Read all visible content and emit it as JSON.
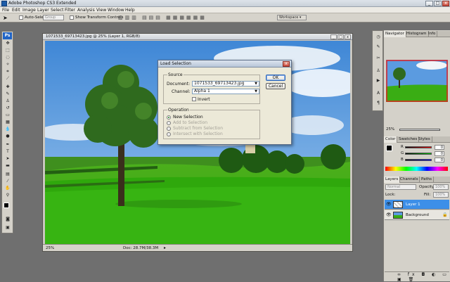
{
  "app": {
    "title": "Adobe Photoshop CS3 Extended",
    "logo": "Ps"
  },
  "menu": [
    "File",
    "Edit",
    "Image",
    "Layer",
    "Select",
    "Filter",
    "Analysis",
    "View",
    "Window",
    "Help"
  ],
  "options": {
    "auto_select": "Auto-Select:",
    "auto_select_value": "Group",
    "show_transform": "Show Transform Controls",
    "workspace": "Workspace"
  },
  "document": {
    "title": "1071533_69713423.jpg @ 25% (Layer 1, RGB/8)",
    "zoom": "25%",
    "doc_info": "Doc: 28.7M/38.3M"
  },
  "dialog": {
    "title": "Load Selection",
    "source_label": "Source",
    "document_label": "Document:",
    "document_value": "1071533_69713423.jpg",
    "channel_label": "Channel:",
    "channel_value": "Alpha 1",
    "invert_label": "Invert",
    "operation_label": "Operation",
    "ops": [
      "New Selection",
      "Add to Selection",
      "Subtract from Selection",
      "Intersect with Selection"
    ],
    "ok": "OK",
    "cancel": "Cancel"
  },
  "navigator": {
    "tabs": [
      "Navigator",
      "Histogram",
      "Info"
    ],
    "zoom": "25%"
  },
  "color": {
    "tabs": [
      "Color",
      "Swatches",
      "Styles"
    ],
    "r_label": "R",
    "g_label": "G",
    "b_label": "B",
    "r": "0",
    "g": "0",
    "b": "0"
  },
  "layers": {
    "tabs": [
      "Layers",
      "Channels",
      "Paths"
    ],
    "blend": "Normal",
    "opacity_label": "Opacity:",
    "opacity": "100%",
    "lock_label": "Lock:",
    "fill_label": "Fill:",
    "fill": "100%",
    "items": [
      "Layer 1",
      "Background"
    ]
  },
  "colors": {
    "selection": "#3d8fe8",
    "accent": "#2064c6"
  }
}
